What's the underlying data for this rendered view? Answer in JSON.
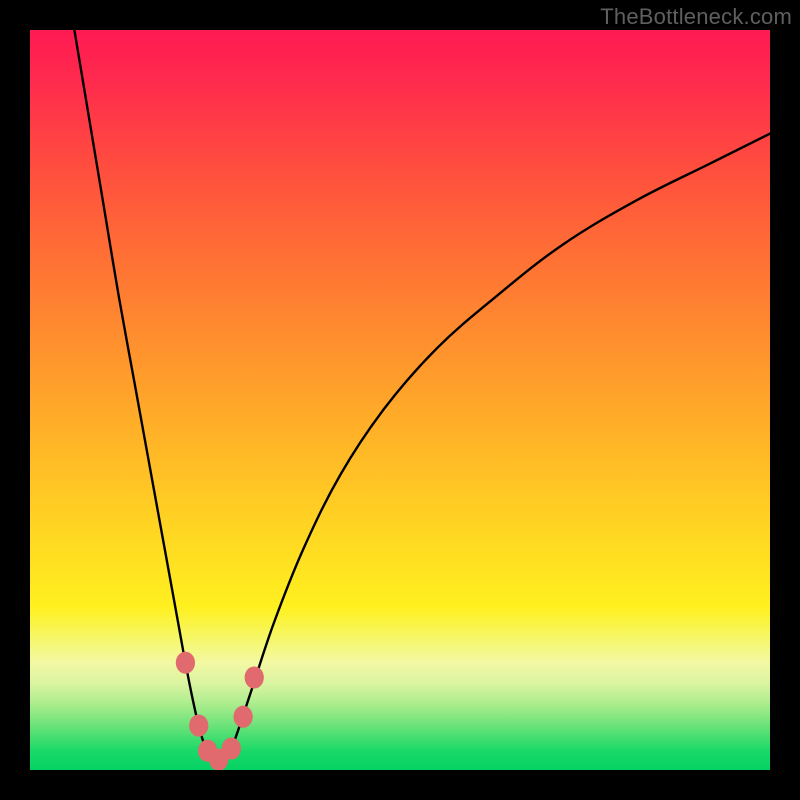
{
  "watermark": "TheBottleneck.com",
  "palette": {
    "black": "#000000",
    "curve": "#000000",
    "marker_fill": "#e06a6e",
    "marker_stroke": "#c74a50"
  },
  "chart_data": {
    "type": "line",
    "title": "",
    "xlabel": "",
    "ylabel": "",
    "xlim": [
      0,
      100
    ],
    "ylim": [
      0,
      100
    ],
    "grid": false,
    "legend": false,
    "background_gradient_stops": [
      {
        "offset": 0.0,
        "color": "#ff1a52"
      },
      {
        "offset": 0.07,
        "color": "#ff2b4d"
      },
      {
        "offset": 0.18,
        "color": "#ff4c3f"
      },
      {
        "offset": 0.3,
        "color": "#ff6e35"
      },
      {
        "offset": 0.42,
        "color": "#ff8f2e"
      },
      {
        "offset": 0.55,
        "color": "#ffb327"
      },
      {
        "offset": 0.68,
        "color": "#ffd722"
      },
      {
        "offset": 0.78,
        "color": "#fff01f"
      },
      {
        "offset": 0.82,
        "color": "#f6f765"
      },
      {
        "offset": 0.855,
        "color": "#f3f8a3"
      },
      {
        "offset": 0.885,
        "color": "#d8f4a0"
      },
      {
        "offset": 0.913,
        "color": "#a7ec8b"
      },
      {
        "offset": 0.945,
        "color": "#5fe176"
      },
      {
        "offset": 0.975,
        "color": "#18d968"
      },
      {
        "offset": 1.0,
        "color": "#05d264"
      }
    ],
    "series": [
      {
        "name": "bottleneck-curve",
        "x": [
          6,
          8,
          10,
          12,
          14,
          16,
          18,
          20,
          21,
          22,
          23,
          24,
          25,
          26,
          27,
          28,
          30,
          33,
          37,
          42,
          48,
          55,
          63,
          72,
          82,
          92,
          100
        ],
        "y": [
          100,
          88,
          76,
          64,
          53,
          42,
          31,
          20,
          14.5,
          9.5,
          5.2,
          2.4,
          1.2,
          1.2,
          2.4,
          5.0,
          11,
          20,
          30,
          40,
          49,
          57,
          64,
          71,
          77,
          82,
          86
        ]
      }
    ],
    "markers": [
      {
        "x": 21.0,
        "y": 14.5
      },
      {
        "x": 22.8,
        "y": 6.0
      },
      {
        "x": 24.0,
        "y": 2.6
      },
      {
        "x": 25.5,
        "y": 1.4
      },
      {
        "x": 27.2,
        "y": 2.9
      },
      {
        "x": 28.8,
        "y": 7.2
      },
      {
        "x": 30.3,
        "y": 12.5
      }
    ],
    "marker_radius": 1.3
  }
}
